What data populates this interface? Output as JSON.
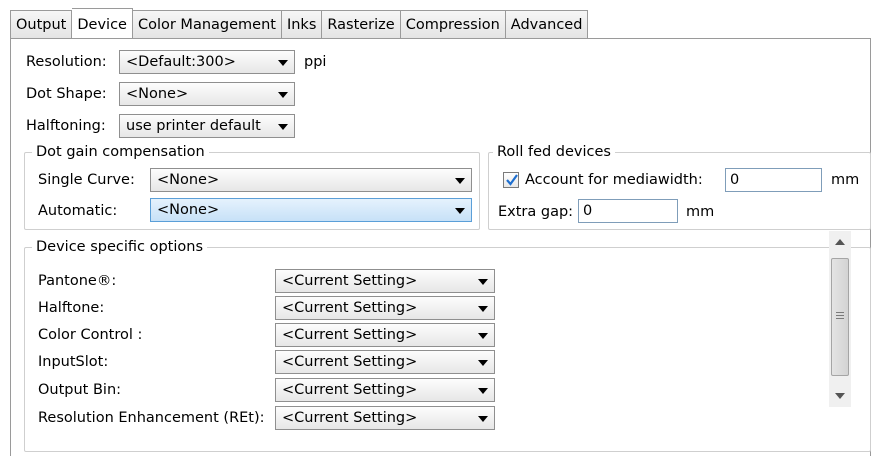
{
  "tabs": [
    "Output",
    "Device",
    "Color Management",
    "Inks",
    "Rasterize",
    "Compression",
    "Advanced"
  ],
  "resolution": {
    "label": "Resolution:",
    "value": "<Default:300>",
    "unit": "ppi"
  },
  "dot_shape": {
    "label": "Dot Shape:",
    "value": "<None>"
  },
  "halftoning": {
    "label": "Halftoning:",
    "value": "use printer default"
  },
  "dot_gain": {
    "title": "Dot gain compensation",
    "single_curve": {
      "label": "Single Curve:",
      "value": "<None>"
    },
    "automatic": {
      "label": "Automatic:",
      "value": "<None>"
    }
  },
  "roll_fed": {
    "title": "Roll fed devices",
    "account": {
      "label": "Account for mediawidth:",
      "checked": true,
      "value": "0",
      "unit": "mm"
    },
    "extra_gap": {
      "label": "Extra gap:",
      "value": "0",
      "unit": "mm"
    }
  },
  "device_options": {
    "title": "Device specific options",
    "rows": [
      {
        "label": "Pantone®:",
        "value": "<Current Setting>"
      },
      {
        "label": "Halftone:",
        "value": "<Current Setting>"
      },
      {
        "label": "Color Control :",
        "value": "<Current Setting>"
      },
      {
        "label": "InputSlot:",
        "value": "<Current Setting>"
      },
      {
        "label": "Output Bin:",
        "value": "<Current Setting>"
      },
      {
        "label": "Resolution Enhancement (REt):",
        "value": "<Current Setting>"
      }
    ]
  },
  "icons": {
    "dropdown": "chevron-down-icon",
    "check": "check-icon",
    "scroll_up": "arrow-up-icon",
    "scroll_down": "arrow-down-icon"
  },
  "colors": {
    "selection": "#c7e1f7",
    "check": "#1f6fcf"
  }
}
